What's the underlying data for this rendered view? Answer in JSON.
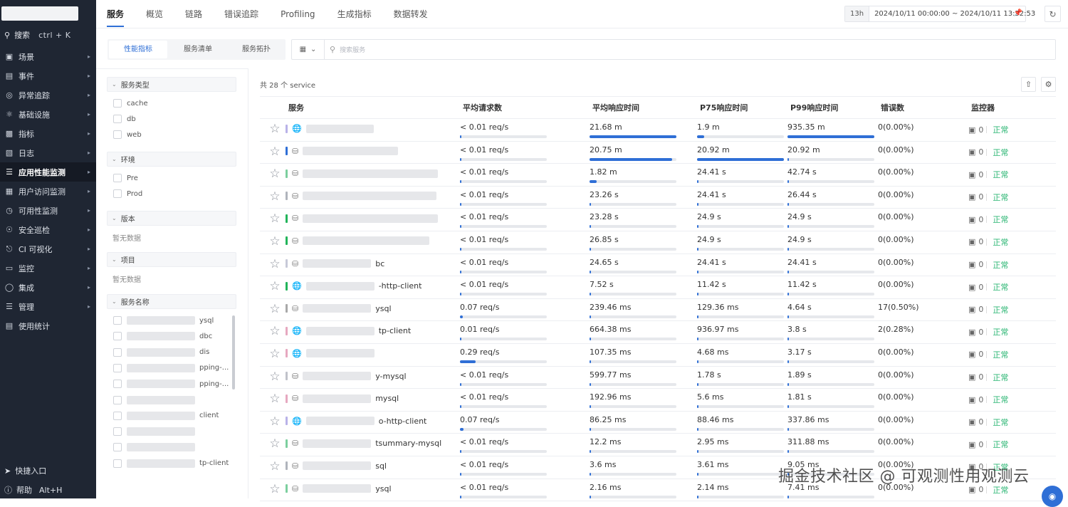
{
  "sidebar": {
    "search_label": "搜索",
    "search_shortcut": "ctrl + K",
    "items": [
      {
        "label": "场景",
        "icon": "monitor-icon"
      },
      {
        "label": "事件",
        "icon": "calendar-icon"
      },
      {
        "label": "异常追踪",
        "icon": "scan-icon"
      },
      {
        "label": "基础设施",
        "icon": "cluster-icon"
      },
      {
        "label": "指标",
        "icon": "chart-icon"
      },
      {
        "label": "日志",
        "icon": "log-icon"
      },
      {
        "label": "应用性能监测",
        "icon": "apm-icon"
      },
      {
        "label": "用户访问监测",
        "icon": "grid-icon"
      },
      {
        "label": "可用性监测",
        "icon": "clock-icon"
      },
      {
        "label": "安全巡检",
        "icon": "shield-icon"
      },
      {
        "label": "CI 可视化",
        "icon": "ci-icon"
      },
      {
        "label": "监控",
        "icon": "monitor-box-icon"
      },
      {
        "label": "集成",
        "icon": "integration-icon"
      },
      {
        "label": "管理",
        "icon": "settings-icon"
      },
      {
        "label": "使用统计",
        "icon": "stats-icon"
      }
    ],
    "quick_entry": "快捷入口",
    "help": "帮助",
    "help_shortcut": "Alt+H"
  },
  "top_tabs": [
    "服务",
    "概览",
    "链路",
    "错误追踪",
    "Profiling",
    "生成指标",
    "数据转发"
  ],
  "time": {
    "badge": "13h",
    "range": "2024/10/11 00:00:00 ~ 2024/10/11 13:52:53"
  },
  "sub_tabs": [
    "性能指标",
    "服务清单",
    "服务拓扑"
  ],
  "search_placeholder": "搜索服务",
  "filters": {
    "service_type": {
      "title": "服务类型",
      "options": [
        "cache",
        "db",
        "web"
      ]
    },
    "env": {
      "title": "环境",
      "options": [
        "Pre",
        "Prod"
      ]
    },
    "version": {
      "title": "版本",
      "empty": "暂无数据"
    },
    "project": {
      "title": "项目",
      "empty": "暂无数据"
    },
    "service_name": {
      "title": "服务名称",
      "options": [
        "ysql",
        "dbc",
        "dis",
        "pping-...",
        "pping-...",
        "",
        "client",
        "",
        "",
        "tp-client"
      ]
    }
  },
  "count_text": "共 28 个 service",
  "table": {
    "headers": [
      "服务",
      "平均请求数",
      "平均响应时间",
      "P75响应时间",
      "P99响应时间",
      "错误数",
      "监控器"
    ],
    "status_ok": "正常",
    "rows": [
      {
        "name": "",
        "type": "globe",
        "color": "#b9b2e8",
        "req": "< 0.01 req/s",
        "req_pct": 0,
        "avg": "21.68 m",
        "avg_pct": 100,
        "p75": "1.9 m",
        "p75_pct": 8,
        "p99": "935.35 m",
        "p99_pct": 100,
        "err": "0(0.00%)",
        "mon": "0"
      },
      {
        "name": "",
        "type": "db",
        "color": "#2f6fd6",
        "req": "< 0.01 req/s",
        "req_pct": 0,
        "avg": "20.75 m",
        "avg_pct": 95,
        "p75": "20.92 m",
        "p75_pct": 100,
        "p99": "20.92 m",
        "p99_pct": 2,
        "err": "0(0.00%)",
        "mon": "0"
      },
      {
        "name": "",
        "type": "db",
        "color": "#7ccf9e",
        "req": "< 0.01 req/s",
        "req_pct": 0,
        "avg": "1.82 m",
        "avg_pct": 8,
        "p75": "24.41 s",
        "p75_pct": 1,
        "p99": "42.74 s",
        "p99_pct": 1,
        "err": "0(0.00%)",
        "mon": "0"
      },
      {
        "name": "",
        "type": "db",
        "color": "#b0b4bc",
        "req": "< 0.01 req/s",
        "req_pct": 0,
        "avg": "23.26 s",
        "avg_pct": 1,
        "p75": "24.41 s",
        "p75_pct": 1,
        "p99": "26.44 s",
        "p99_pct": 1,
        "err": "0(0.00%)",
        "mon": "0"
      },
      {
        "name": "",
        "type": "db",
        "color": "#22b45a",
        "req": "< 0.01 req/s",
        "req_pct": 0,
        "avg": "23.28 s",
        "avg_pct": 1,
        "p75": "24.9 s",
        "p75_pct": 1,
        "p99": "24.9 s",
        "p99_pct": 1,
        "err": "0(0.00%)",
        "mon": "0"
      },
      {
        "name": "",
        "type": "db",
        "color": "#22b45a",
        "req": "< 0.01 req/s",
        "req_pct": 0,
        "avg": "26.85 s",
        "avg_pct": 1,
        "p75": "24.9 s",
        "p75_pct": 1,
        "p99": "24.9 s",
        "p99_pct": 1,
        "err": "0(0.00%)",
        "mon": "0"
      },
      {
        "name": "bc",
        "type": "db",
        "color": "#c7c9d8",
        "req": "< 0.01 req/s",
        "req_pct": 0,
        "avg": "24.65 s",
        "avg_pct": 1,
        "p75": "24.41 s",
        "p75_pct": 1,
        "p99": "24.41 s",
        "p99_pct": 1,
        "err": "0(0.00%)",
        "mon": "0"
      },
      {
        "name": "-http-client",
        "type": "globe",
        "color": "#22b45a",
        "req": "< 0.01 req/s",
        "req_pct": 0,
        "avg": "7.52 s",
        "avg_pct": 1,
        "p75": "11.42 s",
        "p75_pct": 1,
        "p99": "11.42 s",
        "p99_pct": 1,
        "err": "0(0.00%)",
        "mon": "0"
      },
      {
        "name": "ysql",
        "type": "db",
        "color": "#a8a8a8",
        "req": "0.07 req/s",
        "req_pct": 3,
        "avg": "239.46 ms",
        "avg_pct": 0,
        "p75": "129.36 ms",
        "p75_pct": 0,
        "p99": "4.64 s",
        "p99_pct": 0,
        "err": "17(0.50%)",
        "mon": "0"
      },
      {
        "name": "tp-client",
        "type": "globe",
        "color": "#e6a8c0",
        "req": "0.01 req/s",
        "req_pct": 1,
        "avg": "664.38 ms",
        "avg_pct": 0,
        "p75": "936.97 ms",
        "p75_pct": 0,
        "p99": "3.8 s",
        "p99_pct": 0,
        "err": "2(0.28%)",
        "mon": "0"
      },
      {
        "name": "",
        "type": "globe",
        "color": "#e6a8c0",
        "req": "0.29 req/s",
        "req_pct": 18,
        "avg": "107.35 ms",
        "avg_pct": 0,
        "p75": "4.68 ms",
        "p75_pct": 0,
        "p99": "3.17 s",
        "p99_pct": 0,
        "err": "0(0.00%)",
        "mon": "0"
      },
      {
        "name": "y-mysql",
        "type": "db",
        "color": "#c0c2ca",
        "req": "< 0.01 req/s",
        "req_pct": 0,
        "avg": "599.77 ms",
        "avg_pct": 0,
        "p75": "1.78 s",
        "p75_pct": 0,
        "p99": "1.89 s",
        "p99_pct": 0,
        "err": "0(0.00%)",
        "mon": "0"
      },
      {
        "name": "mysql",
        "type": "db",
        "color": "#e6a8c0",
        "req": "< 0.01 req/s",
        "req_pct": 0,
        "avg": "192.96 ms",
        "avg_pct": 0,
        "p75": "5.6 ms",
        "p75_pct": 0,
        "p99": "1.81 s",
        "p99_pct": 0,
        "err": "0(0.00%)",
        "mon": "0"
      },
      {
        "name": "o-http-client",
        "type": "globe",
        "color": "#b9b2e8",
        "req": "0.07 req/s",
        "req_pct": 4,
        "avg": "86.25 ms",
        "avg_pct": 0,
        "p75": "88.46 ms",
        "p75_pct": 0,
        "p99": "337.86 ms",
        "p99_pct": 0,
        "err": "0(0.00%)",
        "mon": "0"
      },
      {
        "name": "tsummary-mysql",
        "type": "db",
        "color": "#7ccf9e",
        "req": "< 0.01 req/s",
        "req_pct": 0,
        "avg": "12.2 ms",
        "avg_pct": 0,
        "p75": "2.95 ms",
        "p75_pct": 0,
        "p99": "311.88 ms",
        "p99_pct": 0,
        "err": "0(0.00%)",
        "mon": "0"
      },
      {
        "name": "sql",
        "type": "db",
        "color": "#b0b4bc",
        "req": "< 0.01 req/s",
        "req_pct": 0,
        "avg": "3.6 ms",
        "avg_pct": 0,
        "p75": "3.61 ms",
        "p75_pct": 0,
        "p99": "9.05 ms",
        "p99_pct": 0,
        "err": "0(0.00%)",
        "mon": "0"
      },
      {
        "name": "ysql",
        "type": "db",
        "color": "#7ccf9e",
        "req": "< 0.01 req/s",
        "req_pct": 0,
        "avg": "2.16 ms",
        "avg_pct": 0,
        "p75": "2.14 ms",
        "p75_pct": 0,
        "p99": "7.41 ms",
        "p99_pct": 0,
        "err": "0(0.00%)",
        "mon": "0"
      }
    ]
  },
  "watermark": "掘金技术社区 @ 可观测性用观测云"
}
